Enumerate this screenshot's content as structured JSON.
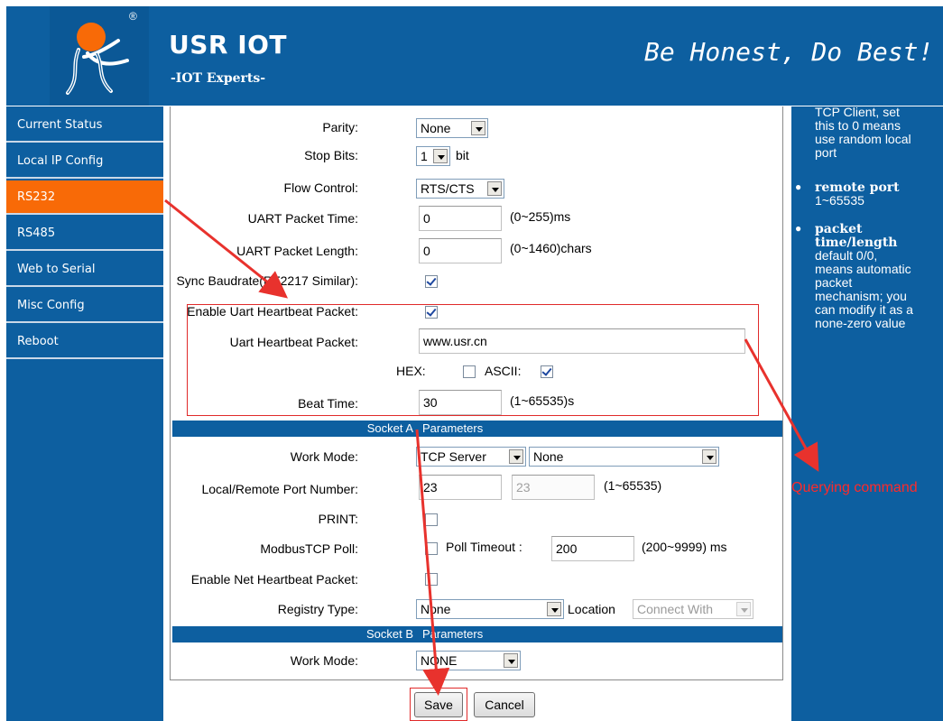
{
  "header": {
    "brand": "USR IOT",
    "brand_sub": "-IOT Experts-",
    "slogan": "Be Honest, Do Best!",
    "registered_mark": "®"
  },
  "sidebar": {
    "items": [
      {
        "label": "Current Status"
      },
      {
        "label": "Local IP Config"
      },
      {
        "label": "RS232",
        "active": true
      },
      {
        "label": "RS485"
      },
      {
        "label": "Web to Serial"
      },
      {
        "label": "Misc Config"
      },
      {
        "label": "Reboot"
      }
    ]
  },
  "form": {
    "parity": {
      "label": "Parity:",
      "value": "None"
    },
    "stop_bits": {
      "label": "Stop Bits:",
      "value": "1",
      "unit": "bit"
    },
    "flow_control": {
      "label": "Flow Control:",
      "value": "RTS/CTS"
    },
    "uart_packet_time": {
      "label": "UART Packet Time:",
      "value": "0",
      "hint": "(0~255)ms"
    },
    "uart_packet_length": {
      "label": "UART Packet Length:",
      "value": "0",
      "hint": "(0~1460)chars"
    },
    "sync_baudrate": {
      "label": "Sync Baudrate(RF2217 Similar):",
      "checked": true
    },
    "enable_uart_heartbeat": {
      "label": "Enable Uart Heartbeat Packet:",
      "checked": true
    },
    "uart_heartbeat_packet": {
      "label": "Uart Heartbeat Packet:",
      "value": "www.usr.cn"
    },
    "hex": {
      "label": "HEX:",
      "checked": false
    },
    "ascii": {
      "label": "ASCII:",
      "checked": true
    },
    "beat_time": {
      "label": "Beat Time:",
      "value": "30",
      "hint": "(1~65535)s"
    },
    "socket_a": {
      "left": "Socket A",
      "right": "Parameters"
    },
    "work_mode_a": {
      "label": "Work Mode:",
      "value": "TCP Server",
      "value2": "None"
    },
    "port_number": {
      "label": "Local/Remote Port Number:",
      "local": "23",
      "remote": "23",
      "hint": "(1~65535)"
    },
    "print": {
      "label": "PRINT:",
      "checked": false
    },
    "modbus_poll": {
      "label": "ModbusTCP Poll:",
      "checked": false,
      "timeout_label": "Poll Timeout :",
      "timeout_value": "200",
      "hint": "(200~9999) ms"
    },
    "enable_net_heartbeat": {
      "label": "Enable Net Heartbeat Packet:",
      "checked": false
    },
    "registry_type": {
      "label": "Registry Type:",
      "value": "None",
      "location_label": "Location",
      "location_value": "Connect With"
    },
    "socket_b": {
      "left": "Socket B",
      "right": "Parameters"
    },
    "work_mode_b": {
      "label": "Work Mode:",
      "value": "NONE"
    }
  },
  "buttons": {
    "save": "Save",
    "cancel": "Cancel"
  },
  "help": {
    "intro": [
      "TCP Client, set",
      "this to 0 means",
      "use random local",
      "port"
    ],
    "remote_port_title": "remote port",
    "remote_port_range": "1~65535",
    "packet_title": [
      "packet",
      "time/length"
    ],
    "packet_desc": [
      "default 0/0,",
      "means automatic",
      "packet",
      "mechanism; you",
      "can modify it as a",
      "none-zero value"
    ]
  },
  "annotation": {
    "querying": "Querying command"
  },
  "colors": {
    "header_blue": "#0d5fa0",
    "active_orange": "#f86a07",
    "annotation_red": "#e02a2a"
  }
}
